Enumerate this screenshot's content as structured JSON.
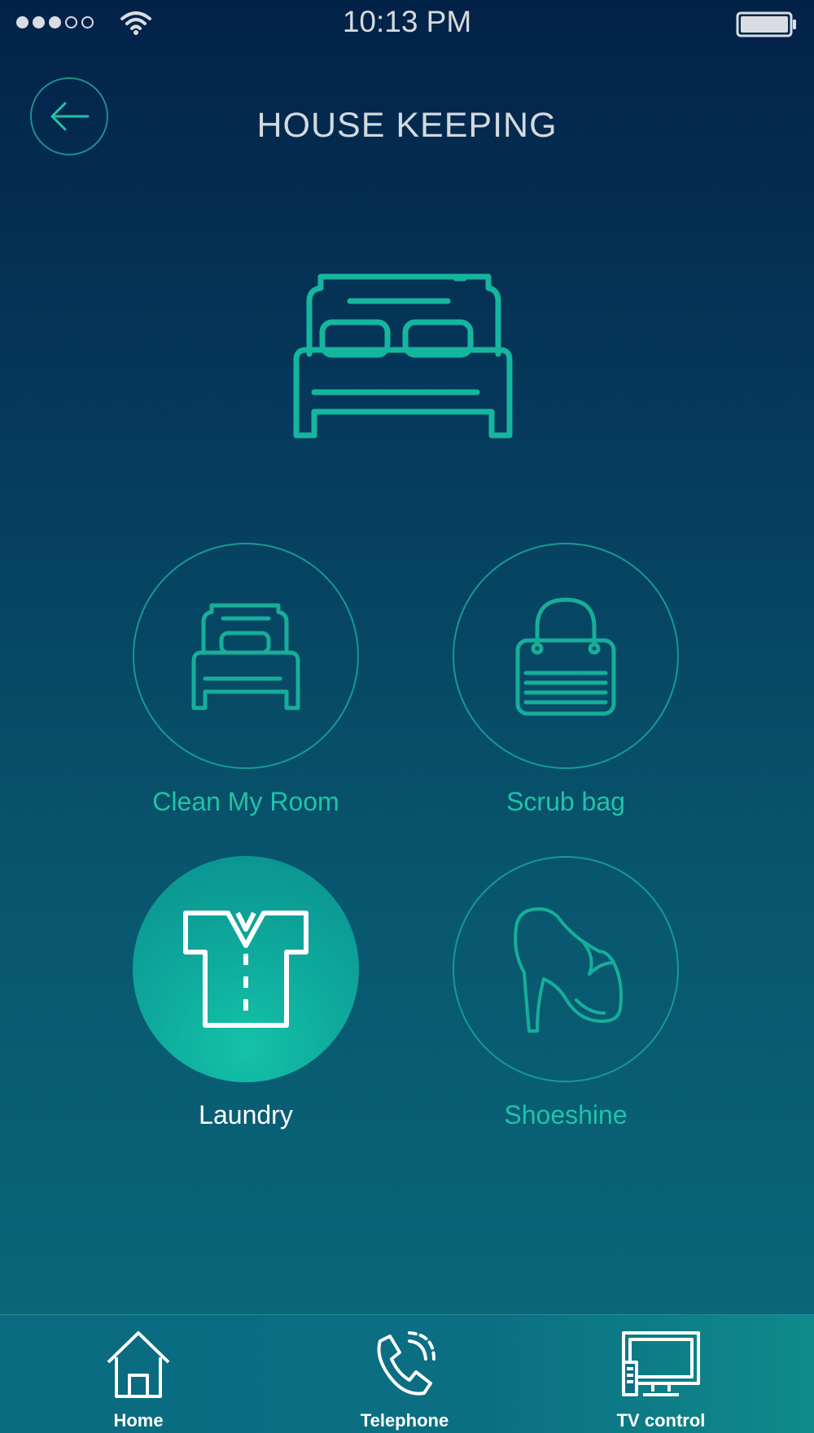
{
  "status_bar": {
    "time": "10:13 PM",
    "signal_bars_filled": 3,
    "signal_bars_total": 5
  },
  "header": {
    "title": "HOUSE KEEPING",
    "back_icon": "arrow-left-icon"
  },
  "hero": {
    "icon": "bed-icon"
  },
  "services": [
    {
      "label": "Clean My Room",
      "icon": "single-bed-icon",
      "active": false
    },
    {
      "label": "Scrub bag",
      "icon": "bag-icon",
      "active": false
    },
    {
      "label": "Laundry",
      "icon": "shirt-icon",
      "active": true
    },
    {
      "label": "Shoeshine",
      "icon": "high-heel-shoe-icon",
      "active": false
    }
  ],
  "tab_bar": [
    {
      "label": "Home",
      "icon": "home-icon"
    },
    {
      "label": "Telephone",
      "icon": "telephone-icon"
    },
    {
      "label": "TV control",
      "icon": "tv-icon"
    }
  ],
  "colors": {
    "accent": "#1fc4a6",
    "outline": "#169a92",
    "background_top": "#032248",
    "background_bottom": "#0a6a7c"
  }
}
